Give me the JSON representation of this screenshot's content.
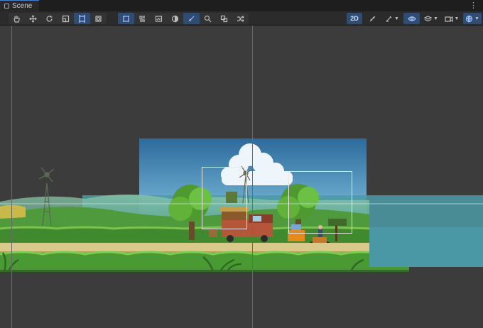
{
  "window": {
    "tab_title": "Scene",
    "menu_glyph": "⋮"
  },
  "toolbar": {
    "tools": [
      {
        "icon": "hand-icon",
        "active": false
      },
      {
        "icon": "move-icon",
        "active": false
      },
      {
        "icon": "rotate-icon",
        "active": false
      },
      {
        "icon": "scale-icon",
        "active": false
      },
      {
        "icon": "rect-transform-icon",
        "active": true
      },
      {
        "icon": "transform-icon",
        "active": false
      }
    ],
    "view_options": [
      {
        "icon": "grid-snap-icon",
        "active": true
      },
      {
        "icon": "layout-icon",
        "active": false
      },
      {
        "icon": "sprite-editor-icon",
        "active": false
      },
      {
        "icon": "shading-icon",
        "active": false
      },
      {
        "icon": "brush-icon",
        "active": true
      },
      {
        "icon": "search-icon",
        "active": false
      },
      {
        "icon": "gizmo-icon",
        "active": false
      },
      {
        "icon": "shuffle-icon",
        "active": false
      }
    ],
    "mode_2d_label": "2D",
    "right_tools": [
      {
        "icon": "lighting-icon",
        "active": false
      },
      {
        "icon": "tool-settings-icon",
        "active": false,
        "dropdown": true
      },
      {
        "icon": "visibility-icon",
        "active": true
      },
      {
        "icon": "layers-icon",
        "active": false,
        "dropdown": true
      },
      {
        "icon": "camera-icon",
        "active": false,
        "dropdown": true
      },
      {
        "icon": "gizmos-globe-icon",
        "active": true,
        "dropdown": true
      }
    ]
  },
  "colors": {
    "sky_top": "#2f6fa2",
    "sky_bottom": "#7fc0e0",
    "grass": "#3f8a2e",
    "path": "#d9c98a",
    "water": "#4a9aa8",
    "accent": "#4a7fd6"
  }
}
